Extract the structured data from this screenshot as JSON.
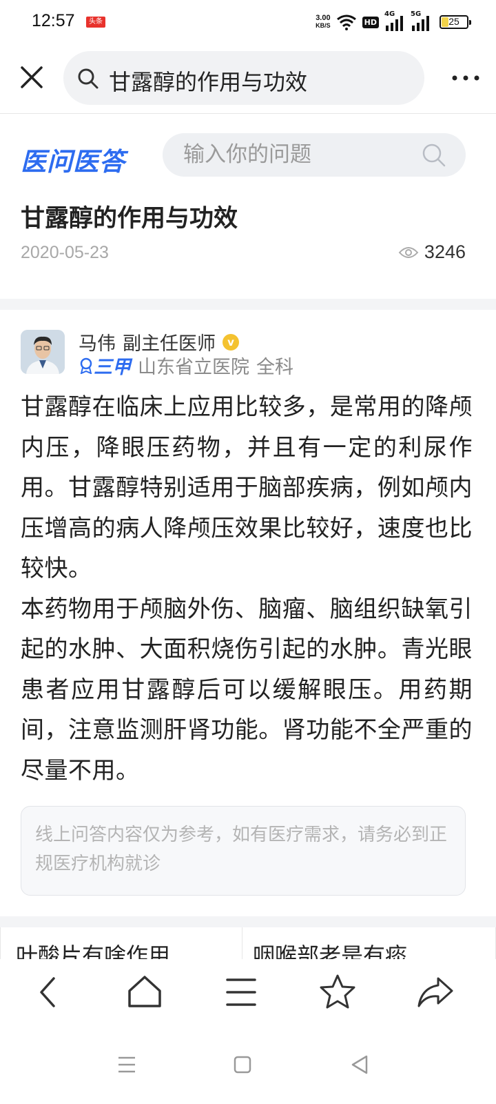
{
  "status_bar": {
    "time": "12:57",
    "notification_badge": "头条",
    "net_speed_value": "3.00",
    "net_speed_unit": "KB/S",
    "hd_label": "HD",
    "signal1_label": "4G",
    "signal2_label": "5G",
    "battery_level": "25"
  },
  "browser": {
    "search_query": "甘露醇的作用与功效"
  },
  "site": {
    "logo_text": "医问医答",
    "search_placeholder": "输入你的问题"
  },
  "article": {
    "title": "甘露醇的作用与功效",
    "date": "2020-05-23",
    "views": "3246"
  },
  "doctor": {
    "name": "马伟",
    "title": "副主任医师",
    "verified_mark": "v",
    "rank": "三甲",
    "hospital": "山东省立医院",
    "department": "全科"
  },
  "answer": {
    "paragraph1": "甘露醇在临床上应用比较多，是常用的降颅内压，降眼压药物，并且有一定的利尿作用。甘露醇特别适用于脑部疾病，例如颅内压增高的病人降颅压效果比较好，速度也比较快。",
    "paragraph2": "本药物用于颅脑外伤、脑瘤、脑组织缺氧引起的水肿、大面积烧伤引起的水肿。青光眼患者应用甘露醇后可以缓解眼压。用药期间，注意监测肝肾功能。肾功能不全严重的尽量不用。"
  },
  "disclaimer": "线上问答内容仅为参考，如有医疗需求，请务必到正规医疗机构就诊",
  "related": {
    "left": "叶酸片有啥作用",
    "right": "咽喉部老是有痰"
  }
}
